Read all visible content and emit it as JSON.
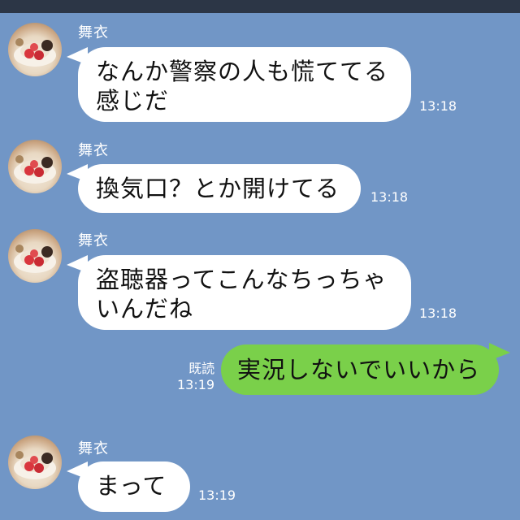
{
  "messages": [
    {
      "sender": "舞衣",
      "text_lines": [
        "なんか警察の人も慌ててる",
        "感じだ"
      ],
      "time": "13:18"
    },
    {
      "sender": "舞衣",
      "text_lines": [
        "換気口？とか開けてる"
      ],
      "time": "13:18"
    },
    {
      "sender": "舞衣",
      "text_lines": [
        "盗聴器ってこんなちっちゃ",
        "いんだね"
      ],
      "time": "13:18"
    },
    {
      "text": "実況しないでいいから",
      "read": "既読",
      "time": "13:19"
    },
    {
      "sender": "舞衣",
      "text_lines": [
        "まって"
      ],
      "time": "13:19"
    }
  ],
  "colors": {
    "background": "#7196c6",
    "incoming_bubble": "#ffffff",
    "outgoing_bubble": "#7ad04a",
    "top_bar": "#2c3646"
  },
  "icons": {
    "avatar": "cake-photo-avatar"
  }
}
